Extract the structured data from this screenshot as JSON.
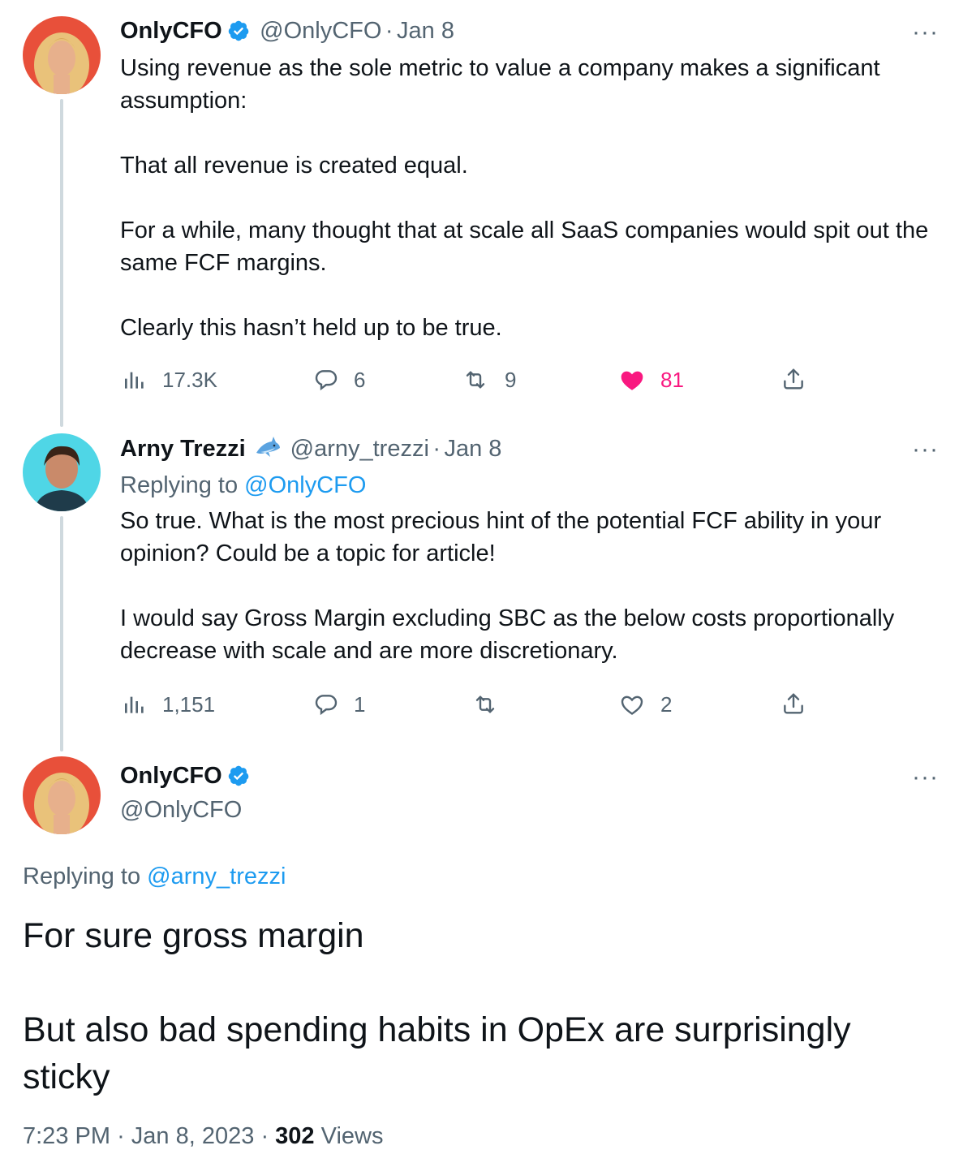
{
  "tweets": [
    {
      "name": "OnlyCFO",
      "handle": "@OnlyCFO",
      "date": "Jan 8",
      "verified": true,
      "text": "Using revenue as the sole metric to value a company makes a significant assumption:\n\nThat all revenue is created equal.\n\nFor a while, many thought that at scale all SaaS companies would spit out the same FCF margins.\n\nClearly this hasn’t held up to be true.",
      "views": "17.3K",
      "replies": "6",
      "retweets": "9",
      "likes": "81",
      "liked": true
    },
    {
      "name": "Arny Trezzi",
      "emoji": "shark-emoji",
      "handle": "@arny_trezzi",
      "date": "Jan 8",
      "reply_prefix": "Replying to",
      "reply_to": "@OnlyCFO",
      "text": "So true. What is the most precious hint of the potential FCF ability in your opinion? Could be a topic for article!\n\nI would say Gross Margin excluding SBC as the below costs proportionally decrease with scale and are more discretionary.",
      "views": "1,151",
      "replies": "1",
      "retweets": "",
      "likes": "2",
      "liked": false
    }
  ],
  "focused": {
    "name": "OnlyCFO",
    "handle": "@OnlyCFO",
    "verified": true,
    "reply_prefix": "Replying to",
    "reply_to": "@arny_trezzi",
    "text": "For sure gross margin\n\nBut also bad spending habits in OpEx are surprisingly sticky",
    "time": "7:23 PM",
    "date": "Jan 8, 2023",
    "views_count": "302",
    "views_label": "Views"
  },
  "more_label": "···",
  "dot": "·",
  "colors": {
    "link": "#1d9bf0",
    "like": "#f91880",
    "muted": "#536471",
    "verified": "#1d9bf0"
  }
}
